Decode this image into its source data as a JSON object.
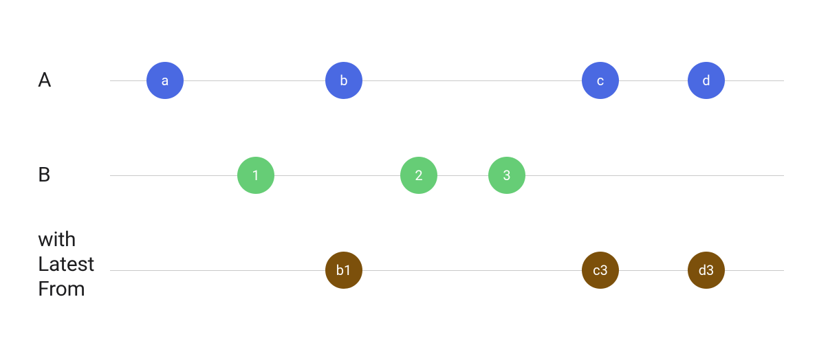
{
  "colors": {
    "blue": "#4a69e2",
    "green": "#66cd76",
    "brown": "#7c500b"
  },
  "rows": {
    "a": {
      "label": "A"
    },
    "b": {
      "label": "B"
    },
    "out": {
      "label": "with\nLatest\nFrom"
    }
  },
  "marbles": {
    "a": [
      {
        "label": "a"
      },
      {
        "label": "b"
      },
      {
        "label": "c"
      },
      {
        "label": "d"
      }
    ],
    "b": [
      {
        "label": "1"
      },
      {
        "label": "2"
      },
      {
        "label": "3"
      }
    ],
    "out": [
      {
        "label": "b1"
      },
      {
        "label": "c3"
      },
      {
        "label": "d3"
      }
    ]
  }
}
